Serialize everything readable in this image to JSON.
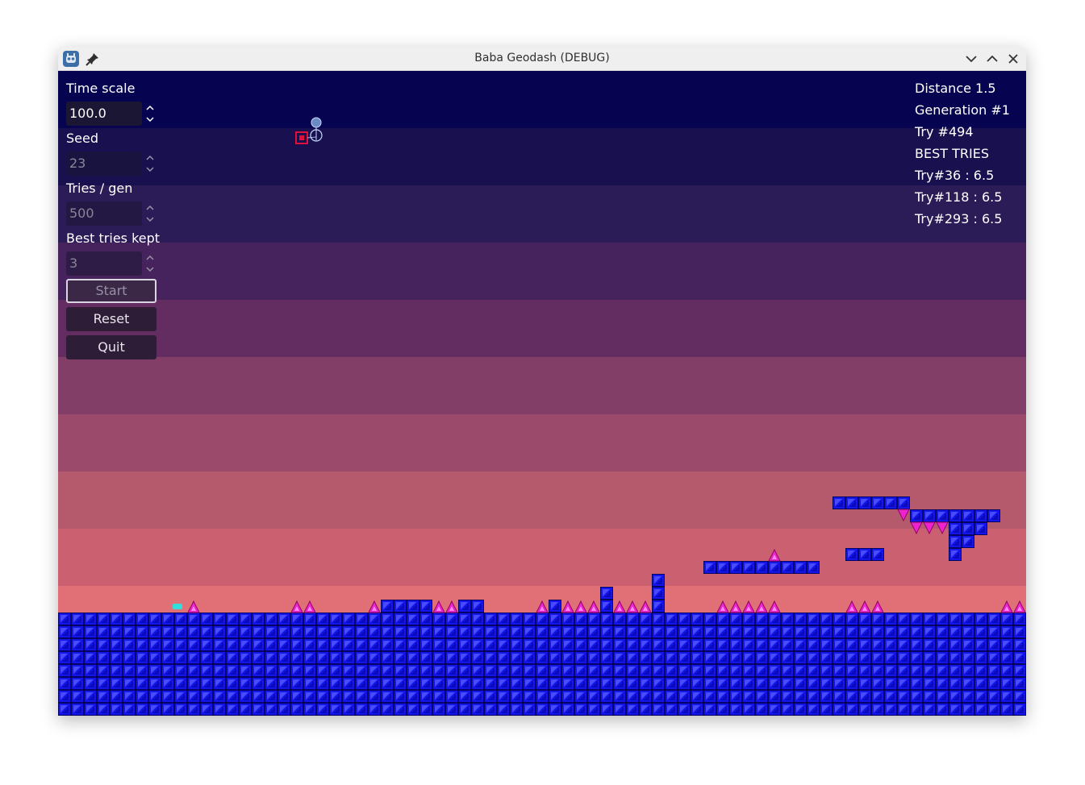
{
  "window": {
    "title": "Baba Geodash (DEBUG)",
    "icons": {
      "app": "godot-icon",
      "pin": "pin-icon",
      "minimize": "chevron-down-icon",
      "maximize": "chevron-up-icon",
      "close": "close-icon"
    }
  },
  "controls": {
    "time_scale": {
      "label": "Time scale",
      "value": "100.0"
    },
    "seed": {
      "label": "Seed",
      "value": "23"
    },
    "tries_per_gen": {
      "label": "Tries / gen",
      "value": "500"
    },
    "best_tries_kept": {
      "label": "Best tries kept",
      "value": "3"
    },
    "start_label": "Start",
    "reset_label": "Reset",
    "quit_label": "Quit"
  },
  "stats": {
    "distance": "Distance 1.5",
    "generation": "Generation #1",
    "try": "Try #494",
    "best_header": "BEST TRIES",
    "best": [
      "Try#36 :  6.5",
      "Try#118 :  6.5",
      "Try#293 :  6.5"
    ]
  },
  "colors": {
    "sky_bands": [
      "#060450",
      "#18104f",
      "#2b1b56",
      "#46235c",
      "#642d61",
      "#823e66",
      "#9b4a6b",
      "#b5596d",
      "#cb6170",
      "#e06f76"
    ],
    "block": "#1414ef",
    "spike": "#ee22cc",
    "player": "#33dddd",
    "accent_red": "#e0103a"
  }
}
